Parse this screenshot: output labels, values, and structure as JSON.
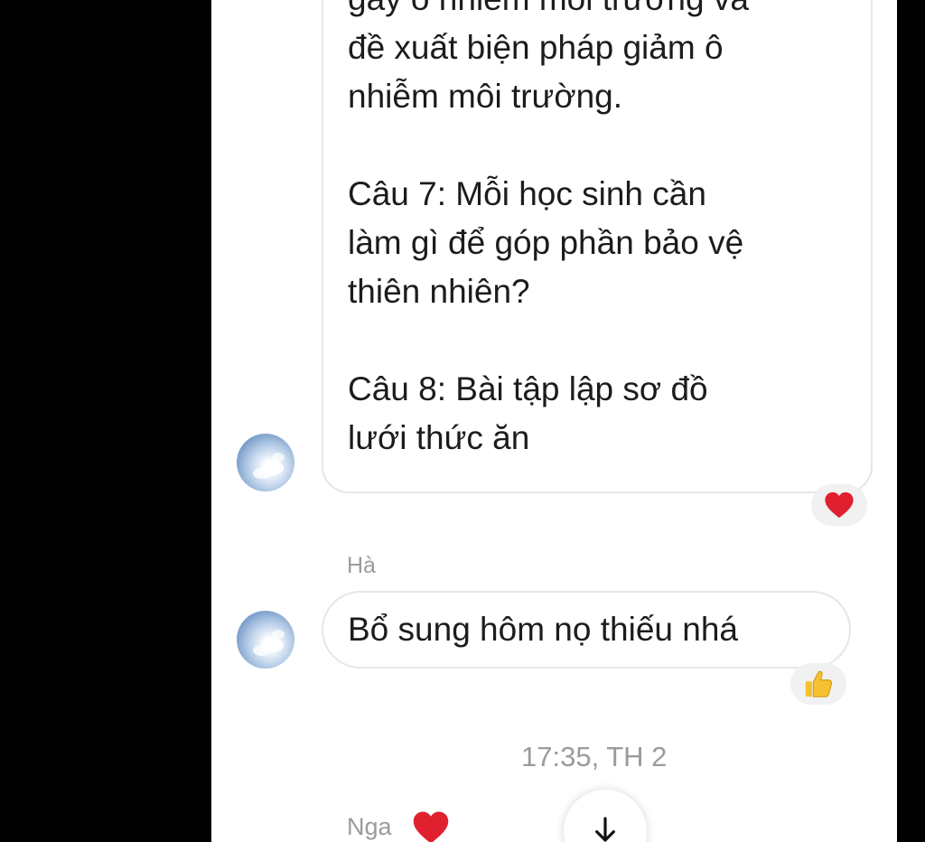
{
  "conversation": {
    "message_1": {
      "lines": [
        "gây ô nhiễm môi trường và",
        "đề xuất biện pháp giảm ô",
        "nhiễm môi trường.",
        "",
        "Câu 7: Mỗi học sinh cần",
        "làm gì để góp phần bảo vệ",
        "thiên nhiên?",
        "",
        "Câu 8: Bài tập lập sơ đồ",
        "lưới thức ăn"
      ],
      "reaction": "heart-icon"
    },
    "sender_name": "Hà",
    "message_2": {
      "text": "Bổ sung hôm nọ thiếu nhá",
      "reaction": "thumbs-up-icon"
    },
    "timestamp": "17:35, TH 2",
    "next_sender": {
      "name": "Nga",
      "reaction": "heart-icon"
    },
    "scroll_down_icon": "arrow-down-icon"
  },
  "colors": {
    "heart": "#e0202e",
    "thumbs_up": "#f6c131",
    "meta_text": "#9b9b9b",
    "bubble_border": "#e6e6e6",
    "reaction_bg": "#f1f1f1"
  }
}
